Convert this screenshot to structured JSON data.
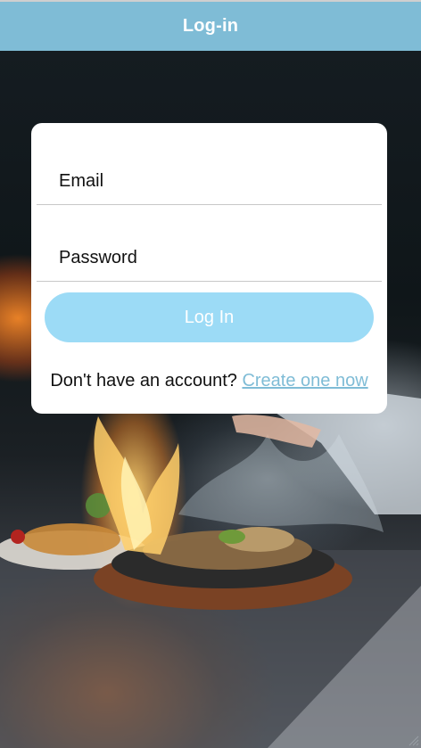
{
  "header": {
    "title": "Log-in"
  },
  "form": {
    "email_label": "Email",
    "password_label": "Password",
    "login_button": "Log In",
    "signup_prompt": "Don't have an account?",
    "signup_link": "Create one now"
  },
  "colors": {
    "header_bg": "#7fbcd6",
    "button_bg": "#9cdbf6",
    "link": "#7fbcd6",
    "card_bg": "#ffffff"
  },
  "icons": {
    "corner": "resize-grip-icon"
  }
}
